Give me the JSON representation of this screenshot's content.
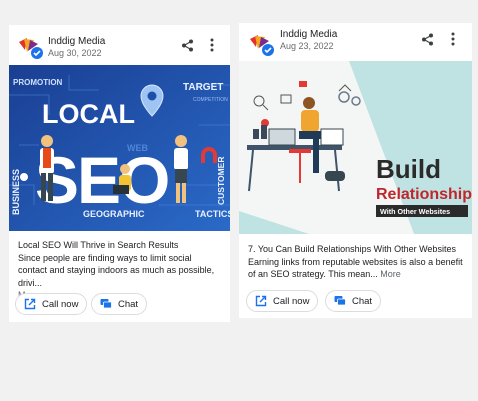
{
  "posts": [
    {
      "business_name": "Inddig Media",
      "date": "Aug 30, 2022",
      "image": {
        "word_top": "LOCAL",
        "word_main": "SEO",
        "keywords": [
          "PROMOTION",
          "TARGET",
          "BUSINESS",
          "CUSTOMER",
          "WEB",
          "GEOGRAPHIC",
          "TACTICS",
          "COMPETITION"
        ]
      },
      "title": "Local SEO Will Thrive in Search Results",
      "body": "Since people are finding ways to limit social contact and staying indoors as much as possible, drivi...",
      "more": "More",
      "call_label": "Call now",
      "chat_label": "Chat"
    },
    {
      "business_name": "Inddig Media",
      "date": "Aug 23, 2022",
      "image": {
        "headline_1": "Build",
        "headline_2": "Relationships",
        "headline_3": "With Other Websites"
      },
      "title": "7. You Can Build Relationships With Other Websites",
      "body": "Earning links from reputable websites is also a benefit of an SEO strategy. This mean...",
      "more": "More",
      "call_label": "Call now",
      "chat_label": "Chat"
    }
  ],
  "colors": {
    "accent_blue": "#1a73e8",
    "seo_bg": "#1f4fa8",
    "relationships_red": "#c0272d",
    "card_bg": "#ffffff",
    "page_bg": "#f1f1f1"
  }
}
